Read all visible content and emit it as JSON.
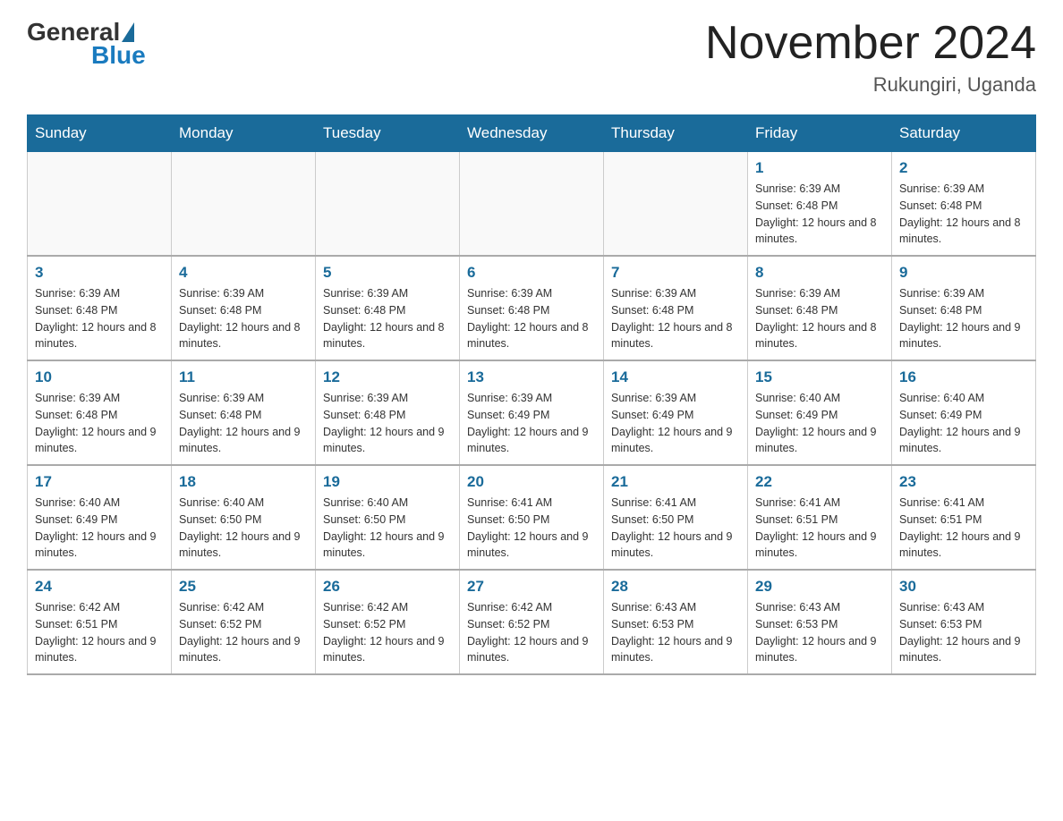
{
  "header": {
    "logo_general": "General",
    "logo_blue": "Blue",
    "month_title": "November 2024",
    "location": "Rukungiri, Uganda"
  },
  "days_of_week": [
    "Sunday",
    "Monday",
    "Tuesday",
    "Wednesday",
    "Thursday",
    "Friday",
    "Saturday"
  ],
  "weeks": [
    [
      {
        "day": "",
        "info": ""
      },
      {
        "day": "",
        "info": ""
      },
      {
        "day": "",
        "info": ""
      },
      {
        "day": "",
        "info": ""
      },
      {
        "day": "",
        "info": ""
      },
      {
        "day": "1",
        "info": "Sunrise: 6:39 AM\nSunset: 6:48 PM\nDaylight: 12 hours and 8 minutes."
      },
      {
        "day": "2",
        "info": "Sunrise: 6:39 AM\nSunset: 6:48 PM\nDaylight: 12 hours and 8 minutes."
      }
    ],
    [
      {
        "day": "3",
        "info": "Sunrise: 6:39 AM\nSunset: 6:48 PM\nDaylight: 12 hours and 8 minutes."
      },
      {
        "day": "4",
        "info": "Sunrise: 6:39 AM\nSunset: 6:48 PM\nDaylight: 12 hours and 8 minutes."
      },
      {
        "day": "5",
        "info": "Sunrise: 6:39 AM\nSunset: 6:48 PM\nDaylight: 12 hours and 8 minutes."
      },
      {
        "day": "6",
        "info": "Sunrise: 6:39 AM\nSunset: 6:48 PM\nDaylight: 12 hours and 8 minutes."
      },
      {
        "day": "7",
        "info": "Sunrise: 6:39 AM\nSunset: 6:48 PM\nDaylight: 12 hours and 8 minutes."
      },
      {
        "day": "8",
        "info": "Sunrise: 6:39 AM\nSunset: 6:48 PM\nDaylight: 12 hours and 8 minutes."
      },
      {
        "day": "9",
        "info": "Sunrise: 6:39 AM\nSunset: 6:48 PM\nDaylight: 12 hours and 9 minutes."
      }
    ],
    [
      {
        "day": "10",
        "info": "Sunrise: 6:39 AM\nSunset: 6:48 PM\nDaylight: 12 hours and 9 minutes."
      },
      {
        "day": "11",
        "info": "Sunrise: 6:39 AM\nSunset: 6:48 PM\nDaylight: 12 hours and 9 minutes."
      },
      {
        "day": "12",
        "info": "Sunrise: 6:39 AM\nSunset: 6:48 PM\nDaylight: 12 hours and 9 minutes."
      },
      {
        "day": "13",
        "info": "Sunrise: 6:39 AM\nSunset: 6:49 PM\nDaylight: 12 hours and 9 minutes."
      },
      {
        "day": "14",
        "info": "Sunrise: 6:39 AM\nSunset: 6:49 PM\nDaylight: 12 hours and 9 minutes."
      },
      {
        "day": "15",
        "info": "Sunrise: 6:40 AM\nSunset: 6:49 PM\nDaylight: 12 hours and 9 minutes."
      },
      {
        "day": "16",
        "info": "Sunrise: 6:40 AM\nSunset: 6:49 PM\nDaylight: 12 hours and 9 minutes."
      }
    ],
    [
      {
        "day": "17",
        "info": "Sunrise: 6:40 AM\nSunset: 6:49 PM\nDaylight: 12 hours and 9 minutes."
      },
      {
        "day": "18",
        "info": "Sunrise: 6:40 AM\nSunset: 6:50 PM\nDaylight: 12 hours and 9 minutes."
      },
      {
        "day": "19",
        "info": "Sunrise: 6:40 AM\nSunset: 6:50 PM\nDaylight: 12 hours and 9 minutes."
      },
      {
        "day": "20",
        "info": "Sunrise: 6:41 AM\nSunset: 6:50 PM\nDaylight: 12 hours and 9 minutes."
      },
      {
        "day": "21",
        "info": "Sunrise: 6:41 AM\nSunset: 6:50 PM\nDaylight: 12 hours and 9 minutes."
      },
      {
        "day": "22",
        "info": "Sunrise: 6:41 AM\nSunset: 6:51 PM\nDaylight: 12 hours and 9 minutes."
      },
      {
        "day": "23",
        "info": "Sunrise: 6:41 AM\nSunset: 6:51 PM\nDaylight: 12 hours and 9 minutes."
      }
    ],
    [
      {
        "day": "24",
        "info": "Sunrise: 6:42 AM\nSunset: 6:51 PM\nDaylight: 12 hours and 9 minutes."
      },
      {
        "day": "25",
        "info": "Sunrise: 6:42 AM\nSunset: 6:52 PM\nDaylight: 12 hours and 9 minutes."
      },
      {
        "day": "26",
        "info": "Sunrise: 6:42 AM\nSunset: 6:52 PM\nDaylight: 12 hours and 9 minutes."
      },
      {
        "day": "27",
        "info": "Sunrise: 6:42 AM\nSunset: 6:52 PM\nDaylight: 12 hours and 9 minutes."
      },
      {
        "day": "28",
        "info": "Sunrise: 6:43 AM\nSunset: 6:53 PM\nDaylight: 12 hours and 9 minutes."
      },
      {
        "day": "29",
        "info": "Sunrise: 6:43 AM\nSunset: 6:53 PM\nDaylight: 12 hours and 9 minutes."
      },
      {
        "day": "30",
        "info": "Sunrise: 6:43 AM\nSunset: 6:53 PM\nDaylight: 12 hours and 9 minutes."
      }
    ]
  ]
}
